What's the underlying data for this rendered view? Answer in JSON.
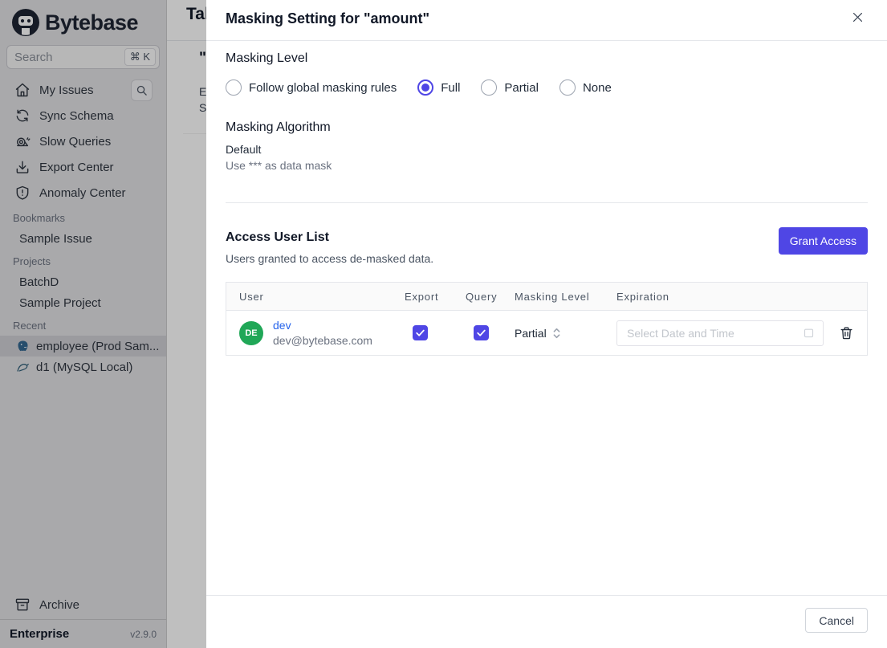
{
  "colors": {
    "accent": "#4f46e5",
    "link_blue": "#2563eb",
    "avatar_green": "#20a757"
  },
  "sidebar": {
    "logo_text": "Bytebase",
    "search_placeholder": "Search",
    "search_shortcut": "⌘ K",
    "nav_items": [
      {
        "icon": "home-icon",
        "label": "My Issues"
      },
      {
        "icon": "sync-icon",
        "label": "Sync Schema"
      },
      {
        "icon": "snail-icon",
        "label": "Slow Queries"
      },
      {
        "icon": "download-icon",
        "label": "Export Center"
      },
      {
        "icon": "shield-icon",
        "label": "Anomaly Center"
      }
    ],
    "groups": [
      {
        "label": "Bookmarks",
        "items": [
          {
            "label": "Sample Issue"
          }
        ]
      },
      {
        "label": "Projects",
        "items": [
          {
            "label": "BatchD"
          },
          {
            "label": "Sample Project"
          }
        ]
      },
      {
        "label": "Recent",
        "items": [
          {
            "icon": "postgres-icon",
            "label": "employee (Prod Sam...",
            "selected": true
          },
          {
            "icon": "mysql-icon",
            "label": "d1 (MySQL Local)",
            "selected": false
          }
        ]
      }
    ],
    "archive_label": "Archive",
    "plan_label": "Enterprise",
    "version": "v2.9.0"
  },
  "background_page": {
    "title_fragment": "Tab",
    "quote_fragment": "\"",
    "fragment_line1": "E",
    "fragment_line2": "S"
  },
  "modal": {
    "title": "Masking Setting for \"amount\"",
    "masking_level": {
      "heading": "Masking Level",
      "options": [
        {
          "label": "Follow global masking rules",
          "selected": false
        },
        {
          "label": "Full",
          "selected": true
        },
        {
          "label": "Partial",
          "selected": false
        },
        {
          "label": "None",
          "selected": false
        }
      ]
    },
    "masking_algorithm": {
      "heading": "Masking Algorithm",
      "name": "Default",
      "description": "Use *** as data mask"
    },
    "access_user_list": {
      "heading": "Access User List",
      "subtitle": "Users granted to access de-masked data.",
      "grant_button_label": "Grant Access",
      "table": {
        "columns": [
          "User",
          "Export",
          "Query",
          "Masking Level",
          "Expiration"
        ],
        "rows": [
          {
            "avatar_initials": "DE",
            "name": "dev",
            "email": "dev@bytebase.com",
            "export_checked": true,
            "query_checked": true,
            "masking_level": "Partial",
            "expiration_placeholder": "Select Date and Time"
          }
        ]
      }
    },
    "footer": {
      "cancel_label": "Cancel"
    }
  }
}
